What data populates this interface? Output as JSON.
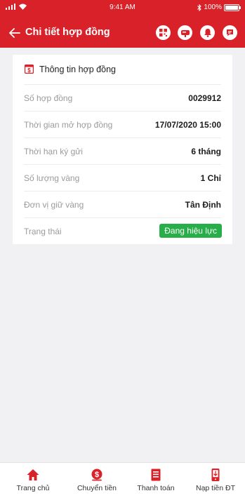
{
  "status_bar": {
    "time": "9:41 AM",
    "battery": "100%",
    "battery_level": 1.0
  },
  "header": {
    "title": "Chi tiết hợp đồng",
    "back_icon": "arrow-left-icon",
    "action_icons": [
      "qr-code-icon",
      "mailbox-icon",
      "bell-icon",
      "chat-icon"
    ]
  },
  "contract": {
    "section_title": "Thông tin hợp đồng",
    "section_icon": "dollar-document-icon",
    "rows": [
      {
        "label": "Số hợp đồng",
        "value": "0029912"
      },
      {
        "label": "Thời gian mở hợp đồng",
        "value": "17/07/2020 15:00"
      },
      {
        "label": "Thời hạn ký gửi",
        "value": "6 tháng"
      },
      {
        "label": "Số lượng vàng",
        "value": "1 Chỉ"
      },
      {
        "label": "Đơn vị giữ vàng",
        "value": "Tân Định"
      },
      {
        "label": "Trạng thái",
        "value": "Đang hiệu lực"
      }
    ]
  },
  "colors": {
    "brand": "#d92129",
    "status_active": "#27ae48"
  },
  "tabbar": {
    "tabs": [
      {
        "label": "Trang chủ",
        "icon": "home-icon"
      },
      {
        "label": "Chuyển tiền",
        "icon": "money-transfer-icon"
      },
      {
        "label": "Thanh toán",
        "icon": "bill-icon"
      },
      {
        "label": "Nạp tiền ĐT",
        "icon": "phone-topup-icon"
      }
    ]
  }
}
